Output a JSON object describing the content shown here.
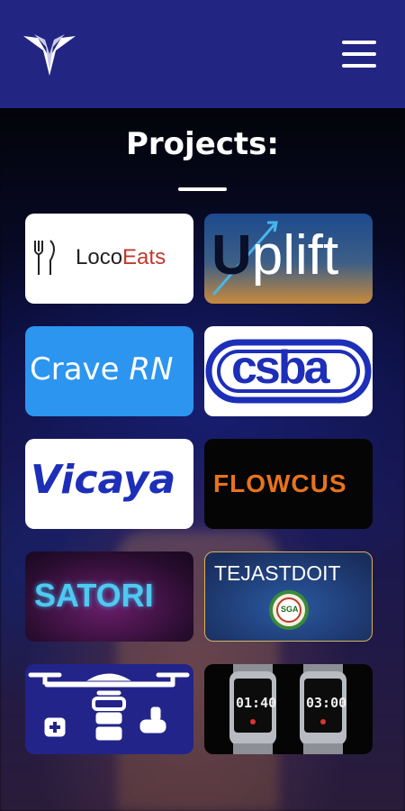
{
  "header": {
    "logo_icon": "winged-logo-icon",
    "menu_icon": "hamburger-menu-icon"
  },
  "page": {
    "title": "Projects:"
  },
  "projects": [
    {
      "name": "LocoEats",
      "loco": "Loco",
      "eats": "Eats"
    },
    {
      "name": "Uplift",
      "u": "U",
      "rest": "plift"
    },
    {
      "name": "Crave RN",
      "a": "Crave",
      "b": "RN"
    },
    {
      "name": "csba"
    },
    {
      "name": "Vicaya"
    },
    {
      "name": "FLOWCUS"
    },
    {
      "name": "SATORI"
    },
    {
      "name": "TEJASTDOIT",
      "badge": "SGA"
    },
    {
      "name": "drone-delivery"
    },
    {
      "name": "smartwatch",
      "time1": "01:40",
      "time2": "03:00"
    }
  ],
  "colors": {
    "header": "#232583",
    "loco_red": "#c0392b",
    "crave_blue": "#2c95f0",
    "vicaya_blue": "#1d2fb8",
    "flowcus_orange": "#e8731c",
    "satori_cyan": "#4fc9f0",
    "drone_navy": "#23248a"
  }
}
